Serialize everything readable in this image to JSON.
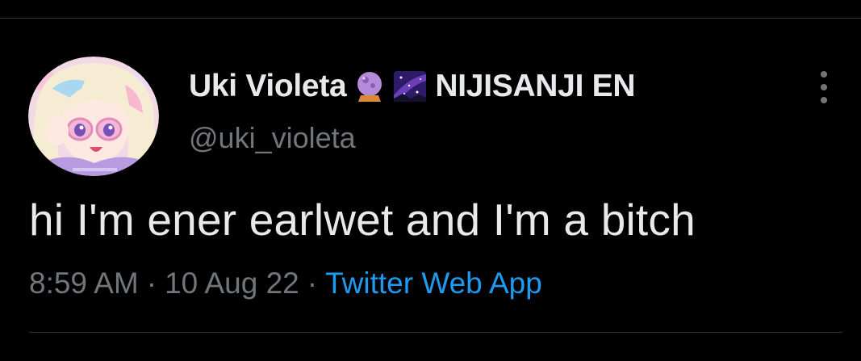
{
  "author": {
    "display_name": "Uki Violeta",
    "affiliation": "NIJISANJI EN",
    "handle": "@uki_violeta",
    "emoji_1": "crystal-ball-emoji",
    "emoji_2": "milky-way-emoji"
  },
  "tweet": {
    "text": "hi I'm ener earlwet and I'm a bitch",
    "time": "8:59 AM",
    "date": "10 Aug 22",
    "separator": "·",
    "source": "Twitter Web App"
  },
  "colors": {
    "background": "#000000",
    "primary_text": "#e7e9ea",
    "secondary_text": "#71767b",
    "link": "#1d9bf0",
    "divider": "#2f3336"
  },
  "icons": {
    "more": "more-vertical-icon"
  }
}
